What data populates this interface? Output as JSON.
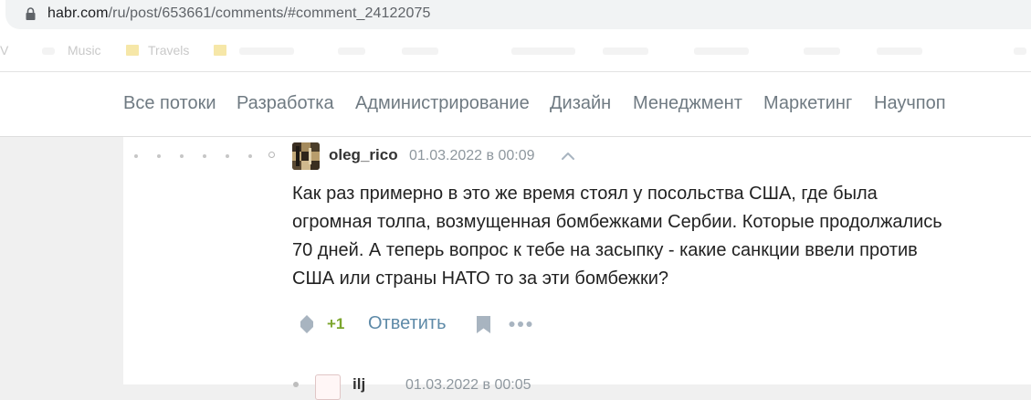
{
  "browser": {
    "url_host": "habr.com",
    "url_path": "/ru/post/653661/comments/#comment_24122075",
    "lock_icon": "lock-icon"
  },
  "bookmarks": {
    "items": [
      "V",
      "Music",
      "Travels"
    ]
  },
  "nav": {
    "items": [
      "Все потоки",
      "Разработка",
      "Администрирование",
      "Дизайн",
      "Менеджмент",
      "Маркетинг",
      "Научпоп"
    ]
  },
  "comment": {
    "username": "oleg_rico",
    "timestamp": "01.03.2022 в 00:09",
    "lines": [
      "Как раз примерно в это же время стоял у посольства США, где была",
      "огромная толпа, возмущенная бомбежками Сербии. Которые продолжались",
      "70 дней. А теперь вопрос к тебе на засыпку - какие санкции ввели против",
      "США или страны НАТО то за эти бомбежки?"
    ],
    "score": "+1",
    "reply_label": "Ответить",
    "icons": {
      "vote": "vote-diamond-icon",
      "bookmark": "bookmark-icon",
      "more": "more-dots-icon",
      "up": "chevron-up-icon"
    }
  },
  "next_comment": {
    "username": "ilj",
    "timestamp": "01.03.2022 в 00:05"
  },
  "colors": {
    "nav_text": "#6f7a82",
    "score": "#7ba52c",
    "reply_link": "#5e8aa8",
    "icon_gray": "#a8b4c0"
  }
}
